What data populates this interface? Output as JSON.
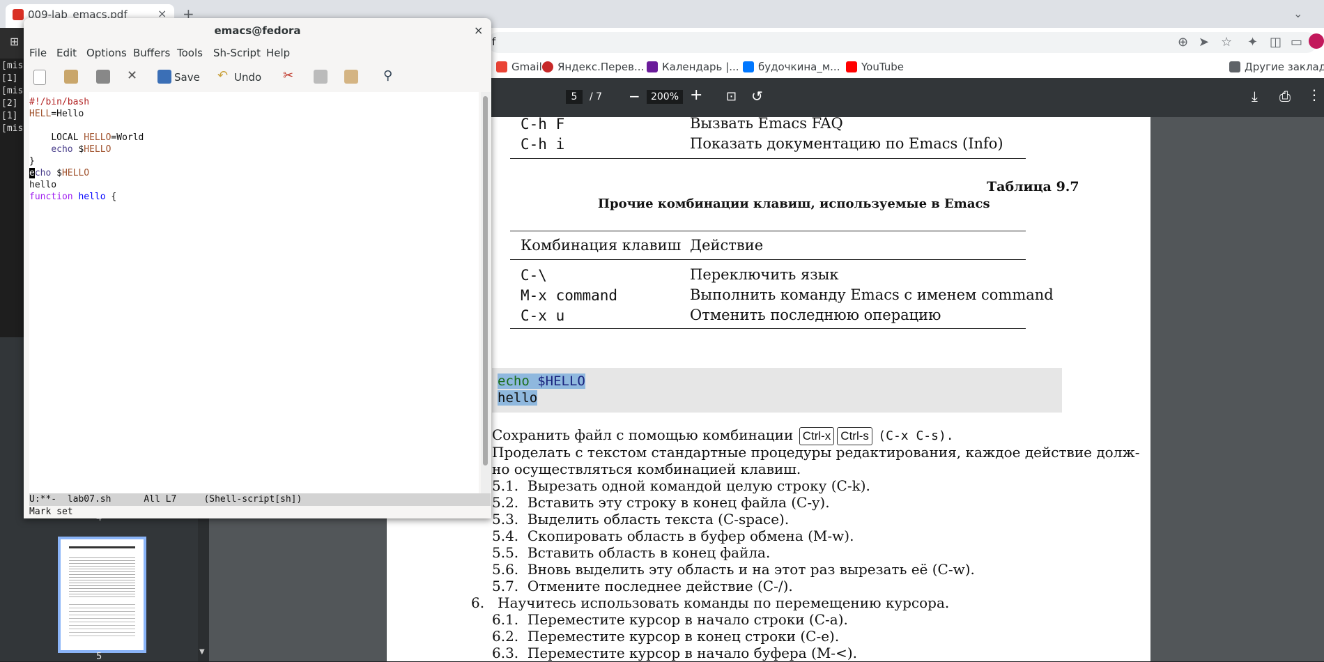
{
  "browser": {
    "tab_title": "009-lab_emacs.pdf",
    "tab_close": "×",
    "new_tab": "+",
    "url_visible": "f",
    "bookmarks": [
      {
        "label": "Gmail",
        "color": "#ea4335"
      },
      {
        "label": "Яндекс.Перев...",
        "color": "#c62828"
      },
      {
        "label": "Календарь |...",
        "color": "#6a1b9a"
      },
      {
        "label": "будочкина_м...",
        "color": "#0077ff"
      },
      {
        "label": "YouTube",
        "color": "#ff0000"
      }
    ],
    "other_bookmarks": "Другие закладк"
  },
  "pdf": {
    "page_current": "5",
    "page_total": "/ 7",
    "zoom": "200%",
    "thumbnails": [
      "4",
      "5"
    ],
    "table1_rows": [
      {
        "key": "C-h F",
        "action": "Вызвать Emacs FAQ"
      },
      {
        "key": "C-h i",
        "action": "Показать документацию по Emacs (Info)"
      }
    ],
    "table_number": "Таблица 9.7",
    "table_caption": "Прочие комбинации клавиш, используемые в Emacs",
    "table_header": {
      "key": "Комбинация клавиш",
      "action": "Действие"
    },
    "table2_rows": [
      {
        "key": "C-\\",
        "action": "Переключить язык"
      },
      {
        "key": "M-x command",
        "action": "Выполнить команду Emacs с именем command"
      },
      {
        "key": "C-x u",
        "action": "Отменить последнюю операцию"
      }
    ],
    "code_line1_a": "echo",
    "code_line1_b": "$HELLO",
    "code_line2": "hello",
    "save_text_a": "Сохранить файл с помощью комбинации",
    "kbd1": "Ctrl-x",
    "kbd2": "Ctrl-s",
    "save_text_b": "(C-x C-s).",
    "para1": "Проделать с текстом стандартные процедуры редактирования, каждое действие долж-",
    "para2": "но осуществляться комбинацией клавиш.",
    "steps": [
      "5.1.  Вырезать одной командой целую строку (C-k).",
      "5.2.  Вставить эту строку в конец файла (C-y).",
      "5.3.  Выделить область текста (C-space).",
      "5.4.  Скопировать область в буфер обмена (M-w).",
      "5.5.  Вставить область в конец файла.",
      "5.6.  Вновь выделить эту область и на этот раз вырезать её (C-w).",
      "5.7.  Отмените последнее действие (C-/)."
    ],
    "item6": "6.   Научитесь использовать команды по перемещению курсора.",
    "steps6": [
      "6.1.  Переместите курсор в начало строки (C-a).",
      "6.2.  Переместите курсор в конец строки (C-e).",
      "6.3.  Переместите курсор в начало буфера (M-<)."
    ]
  },
  "terminal": {
    "lines": "[mis\n[1]\n[mis\n[2]\n[1]\n[mis"
  },
  "emacs": {
    "title": "emacs@fedora",
    "close": "×",
    "menu": [
      "File",
      "Edit",
      "Options",
      "Buffers",
      "Tools",
      "Sh-Script",
      "Help"
    ],
    "save_label": "Save",
    "undo_label": "Undo",
    "code": {
      "l1": "#!/bin/bash",
      "l2a": "HELL",
      "l2b": "=Hello",
      "l4a": "LOCAL ",
      "l4b": "HELLO",
      "l4c": "=World",
      "l5a": "echo",
      "l5b": " $",
      "l5c": "HELLO",
      "l6": "}",
      "l7cursor": "e",
      "l7a": "cho",
      "l7b": " $",
      "l7c": "HELLO",
      "l8": "hello",
      "l9a": "function",
      "l9b": "hello",
      "l9c": " {"
    },
    "modeline": "U:**-  lab07.sh      All L7     (Shell-script[sh])",
    "echo": "Mark set"
  }
}
